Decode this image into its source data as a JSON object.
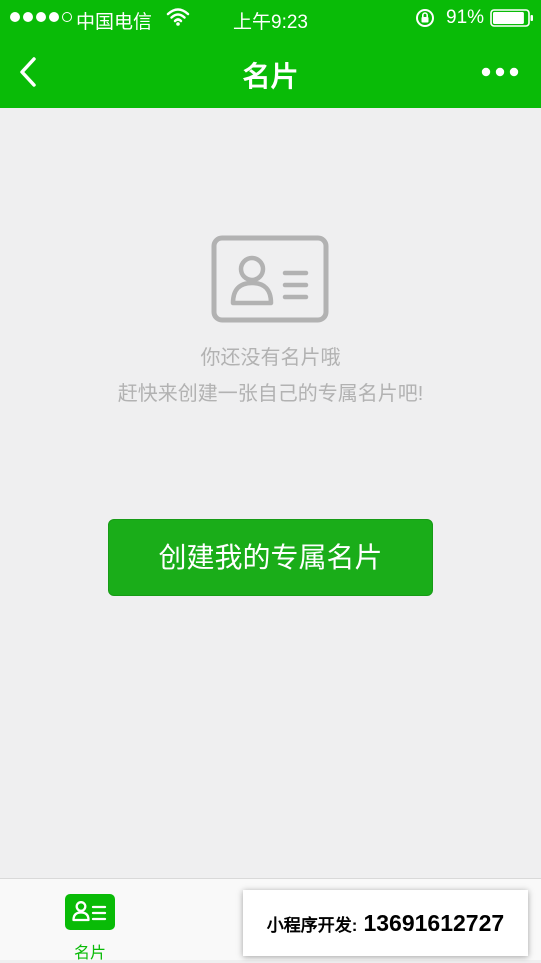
{
  "status_bar": {
    "carrier": "中国电信",
    "time": "上午9:23",
    "battery": "91%",
    "battery_level": 0.91
  },
  "nav": {
    "title": "名片",
    "back_icon": "chevron-left-icon",
    "more_icon": "more-horizontal-icon"
  },
  "empty_state": {
    "icon": "id-card-icon",
    "title": "你还没有名片哦",
    "subtitle": "赶快来创建一张自己的专属名片吧!"
  },
  "create_button": {
    "label": "创建我的专属名片"
  },
  "tabs": [
    {
      "label": "名片",
      "icon": "id-card-icon",
      "active": true
    },
    {
      "label": "",
      "icon": "",
      "active": false
    },
    {
      "label": "",
      "icon": "",
      "active": false
    }
  ],
  "watermark": {
    "label": "小程序开发:",
    "phone": "13691612727"
  },
  "colors": {
    "brand_green": "#09bb07",
    "button_green": "#1aad19",
    "background": "#efeff0",
    "muted_text": "#b2b2b2"
  }
}
